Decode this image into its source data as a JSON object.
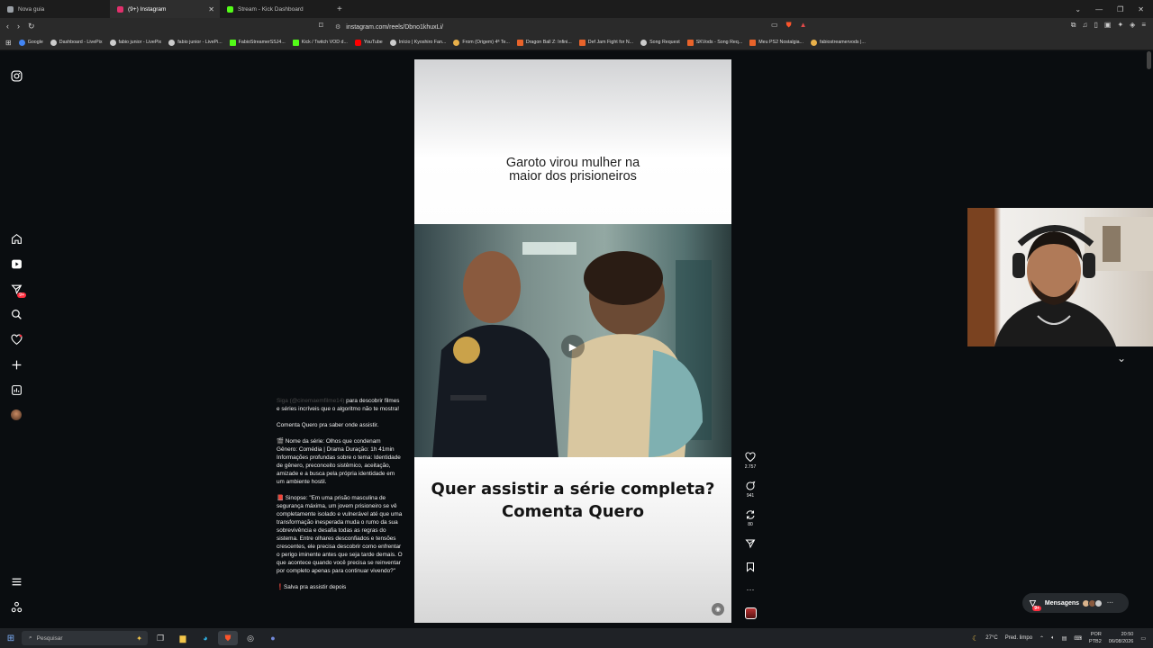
{
  "browser": {
    "tabs": [
      {
        "label": "Nova guia",
        "color": "#9aa0a6",
        "active": false
      },
      {
        "label": "(9+) Instagram",
        "color": "#e1306c",
        "active": true
      },
      {
        "label": "Stream - Kick Dashboard",
        "color": "#53fc18",
        "active": false
      }
    ],
    "new_tab": "+",
    "url": "instagram.com/reels/Dbno1khuxLi/",
    "bookmarks": [
      {
        "label": "Google",
        "color": "#4285f4"
      },
      {
        "label": "Dashboard - LivePix",
        "color": "#cccccc"
      },
      {
        "label": "fabio junior - LivePix",
        "color": "#cccccc"
      },
      {
        "label": "fabio junior - LivePi...",
        "color": "#cccccc"
      },
      {
        "label": "FabioStreamerSSJ4...",
        "color": "#53fc18"
      },
      {
        "label": "Kick / Twitch VOD d...",
        "color": "#53fc18"
      },
      {
        "label": "YouTube",
        "color": "#ff0000"
      },
      {
        "label": "Início | Kyoshiro Fan...",
        "color": "#cccccc"
      },
      {
        "label": "From (Origem) 4ª Te...",
        "color": "#e8b04a"
      },
      {
        "label": "Dragon Ball Z: Infini...",
        "color": "#e8632a"
      },
      {
        "label": "Def Jam Fight for N...",
        "color": "#e8632a"
      },
      {
        "label": "Song Request",
        "color": "#cccccc"
      },
      {
        "label": "SKVods - Song Req...",
        "color": "#e8632a"
      },
      {
        "label": "Meu PS2 Nostalgia...",
        "color": "#e8632a"
      },
      {
        "label": "fabiostreamervods |...",
        "color": "#e8b04a"
      }
    ]
  },
  "sidebar": {
    "notifications_badge": "9+"
  },
  "caption": {
    "intro_dim": "Siga (@cinemaemfilme14)",
    "intro": " para descobrir filmes e séries incríveis que o algoritmo não te mostra!",
    "cta": "Comenta Quero pra saber onde assistir.",
    "info": "🎬 Nome da série: Olhos que condenam Gênero: Comédia | Drama Duração: 1h 41min Informações profundas sobre o tema: Identidade de gênero, preconceito sistêmico, aceitação, amizade e a busca pela própria identidade em um ambiente hostil.",
    "synopsis": "📕 Sinopse: \"Em uma prisão masculina de segurança máxima, um jovem prisioneiro se vê completamente isolado e vulnerável até que uma transformação inesperada muda o rumo da sua sobrevivência e desafia todas as regras do sistema. Entre olhares desconfiados e tensões crescentes, ele precisa descobrir como enfrentar o perigo iminente antes que seja tarde demais. O que acontece quando você precisa se reinventar por completo apenas para continuar vivendo?\"",
    "save": "❗Salva pra assistir depois"
  },
  "reel": {
    "hook_line1": "Garoto virou mulher na",
    "hook_line2": "maior dos prisioneiros",
    "cta_line1": "Quer assistir a série completa?",
    "cta_line2": "Comenta Quero"
  },
  "actions": {
    "likes": "2.757",
    "comments": "941",
    "reposts": "80"
  },
  "messages": {
    "label": "Mensagens",
    "badge": "9+"
  },
  "taskbar": {
    "search_placeholder": "Pesquisar",
    "weather": "27°C",
    "weather_desc": "Pred. limpo",
    "lang1": "POR",
    "lang2": "PTB2",
    "time": "20:50",
    "date": "06/08/2026"
  }
}
